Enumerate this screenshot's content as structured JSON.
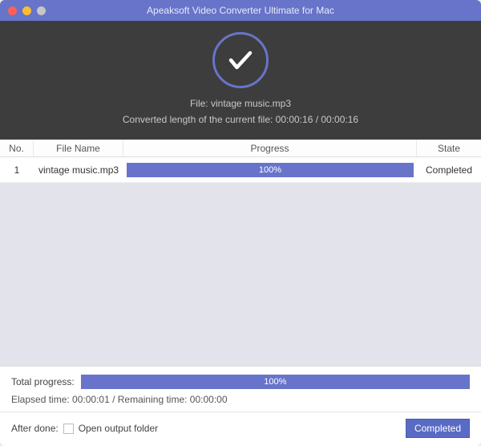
{
  "window": {
    "title": "Apeaksoft Video Converter Ultimate for Mac"
  },
  "hero": {
    "file_prefix": "File: ",
    "file_name": "vintage music.mp3",
    "converted_line": "Converted length of the current file: 00:00:16 / 00:00:16"
  },
  "headers": {
    "no": "No.",
    "name": "File Name",
    "progress": "Progress",
    "state": "State"
  },
  "rows": [
    {
      "no": "1",
      "name": "vintage music.mp3",
      "progress_text": "100%",
      "state": "Completed"
    }
  ],
  "footer": {
    "total_label": "Total progress:",
    "total_percent": "100%",
    "time_line": "Elapsed time: 00:00:01 / Remaining time: 00:00:00",
    "after_done_label": "After done:",
    "open_folder_label": "Open output folder",
    "completed_button": "Completed"
  }
}
